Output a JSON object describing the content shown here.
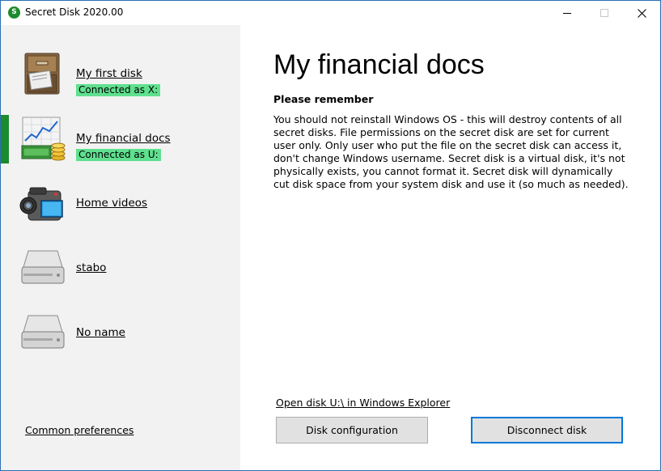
{
  "window": {
    "title": "Secret Disk 2020.00",
    "app_icon_glyph": "ᴢ5"
  },
  "sidebar": {
    "disks": [
      {
        "name": "My first disk",
        "status": "Connected as X:",
        "icon": "cabinet-icon",
        "selected": false
      },
      {
        "name": "My financial docs",
        "status": "Connected as U:",
        "icon": "money-chart-icon",
        "selected": true
      },
      {
        "name": "Home videos",
        "status": "",
        "icon": "video-camera-icon",
        "selected": false
      },
      {
        "name": "stabo",
        "status": "",
        "icon": "hard-drive-icon",
        "selected": false
      },
      {
        "name": "No name",
        "status": "",
        "icon": "hard-drive-icon",
        "selected": false
      }
    ],
    "common_preferences": "Common preferences"
  },
  "main": {
    "title": "My financial docs",
    "remember_heading": "Please remember",
    "body": "You should not reinstall Windows OS - this will destroy contents of all secret disks. File permissions on the secret disk are set for current user only. Only user who put the file on the secret disk can access it, don't change Windows username. Secret disk is a virtual disk, it's not physically exists, you cannot format it. Secret disk will dynamically cut disk space from your system disk and use it (so much as needed).",
    "open_link": "Open disk U:\\ in Windows Explorer",
    "disk_config_button": "Disk configuration",
    "disconnect_button": "Disconnect disk"
  },
  "colors": {
    "accent": "#1c8a2e",
    "status_bg": "#5fe08f",
    "focus_border": "#0078d7"
  }
}
